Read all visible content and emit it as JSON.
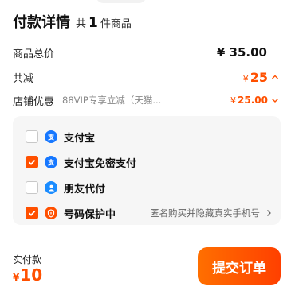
{
  "header": {
    "title": "付款详情",
    "count_prefix": "共",
    "count": "1",
    "count_suffix": "件商品"
  },
  "summary": {
    "total_label": "商品总价",
    "total_value": "¥ 35.00",
    "discount_label": "共减",
    "discount_symbol": "¥",
    "discount_value": "25",
    "store_label": "店铺优惠",
    "store_desc": "88VIP专享立减（天猫...",
    "store_symbol": "¥",
    "store_value": "25.00"
  },
  "payment_options": [
    {
      "name": "支付宝",
      "icon": "alipay-icon",
      "checked": false
    },
    {
      "name": "支付宝免密支付",
      "icon": "alipay-icon",
      "checked": true
    },
    {
      "name": "朋友代付",
      "icon": "friend-pay-icon",
      "checked": false
    },
    {
      "name": "号码保护中",
      "icon": "shield-icon",
      "checked": true,
      "desc": "匿名购买并隐藏真实手机号"
    }
  ],
  "footer": {
    "paid_label": "实付款",
    "paid_symbol": "¥",
    "paid_value": "10",
    "submit_label": "提交订单"
  },
  "colors": {
    "accent": "#ff5000",
    "alipay": "#1677ff",
    "panel": "#f6f6f6"
  }
}
